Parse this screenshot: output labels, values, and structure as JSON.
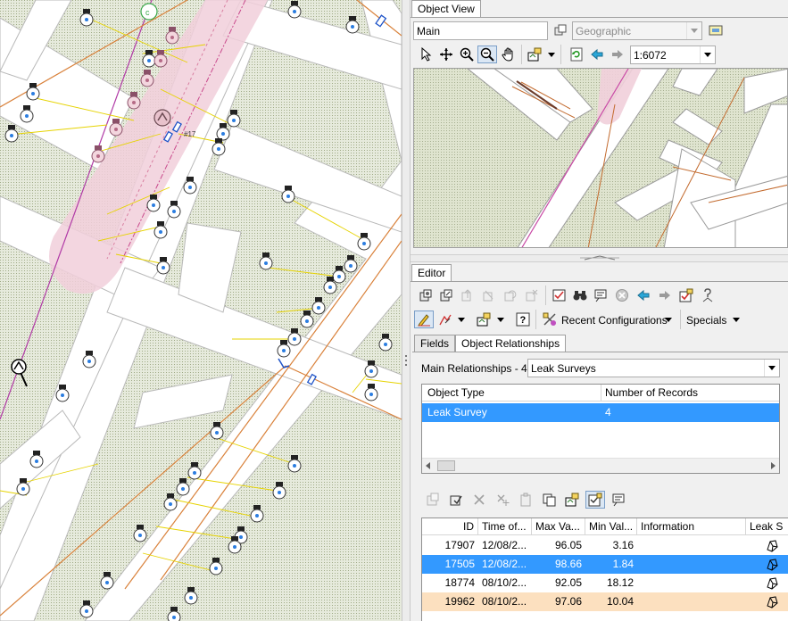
{
  "object_view": {
    "tab_label": "Object View",
    "map_name": "Main",
    "coord_system": "Geographic",
    "scale": "1:6072"
  },
  "map": {
    "label_17": "#17"
  },
  "editor": {
    "tab_label": "Editor",
    "recent_configurations": "Recent Configurations",
    "specials": "Specials",
    "tabs": [
      "Fields",
      "Object Relationships"
    ],
    "relationships_label": "Main Relationships - 4",
    "relationship_selected": "Leak Surveys",
    "rel_table": {
      "headers": [
        "Object Type",
        "Number of Records"
      ],
      "rows": [
        {
          "type": "Leak Survey",
          "count": "4"
        }
      ]
    },
    "records_table": {
      "headers": [
        "ID",
        "Time of...",
        "Max Va...",
        "Min Val...",
        "Information",
        "Leak S"
      ],
      "rows": [
        {
          "id": "17907",
          "time": "12/08/2...",
          "max": "96.05",
          "min": "3.16",
          "info": ""
        },
        {
          "id": "17505",
          "time": "12/08/2...",
          "max": "98.66",
          "min": "1.84",
          "info": ""
        },
        {
          "id": "18774",
          "time": "08/10/2...",
          "max": "92.05",
          "min": "18.12",
          "info": ""
        },
        {
          "id": "19962",
          "time": "08/10/2...",
          "max": "97.06",
          "min": "10.04",
          "info": ""
        }
      ]
    }
  },
  "colors": {
    "selection": "#3399ff",
    "highlight_row": "#fce0bf",
    "map_parcel": "#dfe4cf",
    "map_road": "#ffffff",
    "pipe_main": "#d9813a",
    "service_line": "#e6d300"
  }
}
